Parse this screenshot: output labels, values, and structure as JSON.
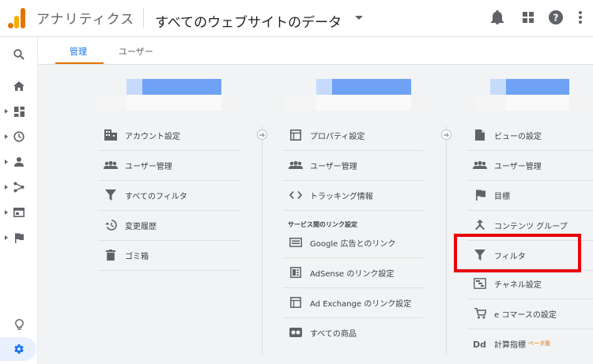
{
  "header": {
    "app_title": "アナリティクス",
    "view_title": "すべてのウェブサイトのデータ"
  },
  "tabs": [
    {
      "label": "管理"
    },
    {
      "label": "ユーザー"
    }
  ],
  "account_menu": [
    {
      "label": "アカウント設定",
      "icon": "building-icon"
    },
    {
      "label": "ユーザー管理",
      "icon": "people-icon"
    },
    {
      "label": "すべてのフィルタ",
      "icon": "filter-icon"
    },
    {
      "label": "変更履歴",
      "icon": "history-icon"
    },
    {
      "label": "ゴミ箱",
      "icon": "trash-icon"
    }
  ],
  "property_menu": {
    "top": [
      {
        "label": "プロパティ設定",
        "icon": "property-icon"
      },
      {
        "label": "ユーザー管理",
        "icon": "people-icon"
      },
      {
        "label": "トラッキング情報",
        "icon": "code-icon"
      }
    ],
    "section_label": "サービス間のリンク設定",
    "links": [
      {
        "label": "Google 広告とのリンク",
        "icon": "ads-icon"
      },
      {
        "label": "AdSense のリンク設定",
        "icon": "adsense-icon"
      },
      {
        "label": "Ad Exchange のリンク設定",
        "icon": "adexchange-icon"
      },
      {
        "label": "すべての商品",
        "icon": "products-icon"
      }
    ]
  },
  "view_menu": [
    {
      "label": "ビューの設定",
      "icon": "document-icon"
    },
    {
      "label": "ユーザー管理",
      "icon": "people-icon"
    },
    {
      "label": "目標",
      "icon": "flag-icon"
    },
    {
      "label": "コンテンツ グループ",
      "icon": "content-group-icon"
    },
    {
      "label": "フィルタ",
      "icon": "filter-icon"
    },
    {
      "label": "チャネル設定",
      "icon": "channel-icon"
    },
    {
      "label": "e コマースの設定",
      "icon": "cart-icon"
    },
    {
      "label": "計算指標",
      "icon": "dd-icon",
      "badge": "ベータ版"
    }
  ],
  "colors": {
    "accent_blue": "#1a73e8",
    "accent_orange": "#e37400",
    "highlight_red": "#e8000b"
  }
}
